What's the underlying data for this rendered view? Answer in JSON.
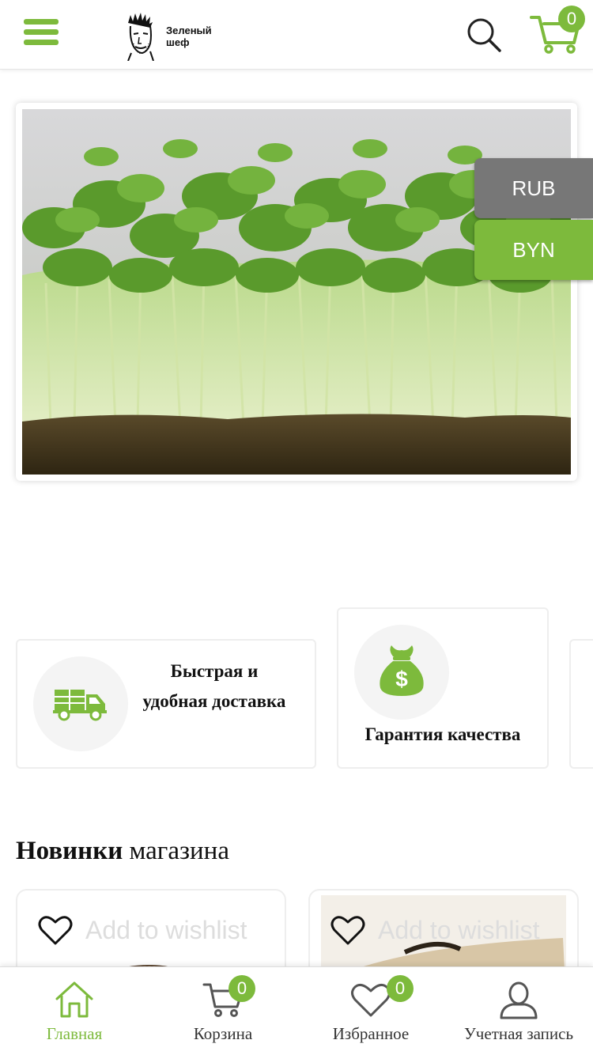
{
  "brand": {
    "logo_line1": "Зеленый",
    "logo_line2": "шеф",
    "accent_color": "#7dba3c"
  },
  "header": {
    "menu_icon": "hamburger-icon",
    "search_icon": "search-icon",
    "cart_icon": "cart-icon",
    "cart_count": "0"
  },
  "currency": {
    "options": [
      "RUB",
      "BYN"
    ],
    "selected": "BYN"
  },
  "features": [
    {
      "icon": "delivery-truck-icon",
      "line1": "Быстрая и",
      "line2": "удобная доставка"
    },
    {
      "icon": "money-bag-icon",
      "line1": "Гарантия качества"
    }
  ],
  "section": {
    "title_bold": "Новинки",
    "title_rest": " магазина"
  },
  "products": [
    {
      "wishlist_label": "Add to wishlist",
      "icon": "heart-icon"
    },
    {
      "wishlist_label": "Add to wishlist",
      "icon": "heart-icon"
    }
  ],
  "bottom_nav": {
    "items": [
      {
        "label": "Главная",
        "icon": "home-icon",
        "active": true
      },
      {
        "label": "Корзина",
        "icon": "cart-icon",
        "badge": "0"
      },
      {
        "label": "Избранное",
        "icon": "heart-icon",
        "badge": "0"
      },
      {
        "label": "Учетная запись",
        "icon": "user-icon"
      }
    ]
  }
}
